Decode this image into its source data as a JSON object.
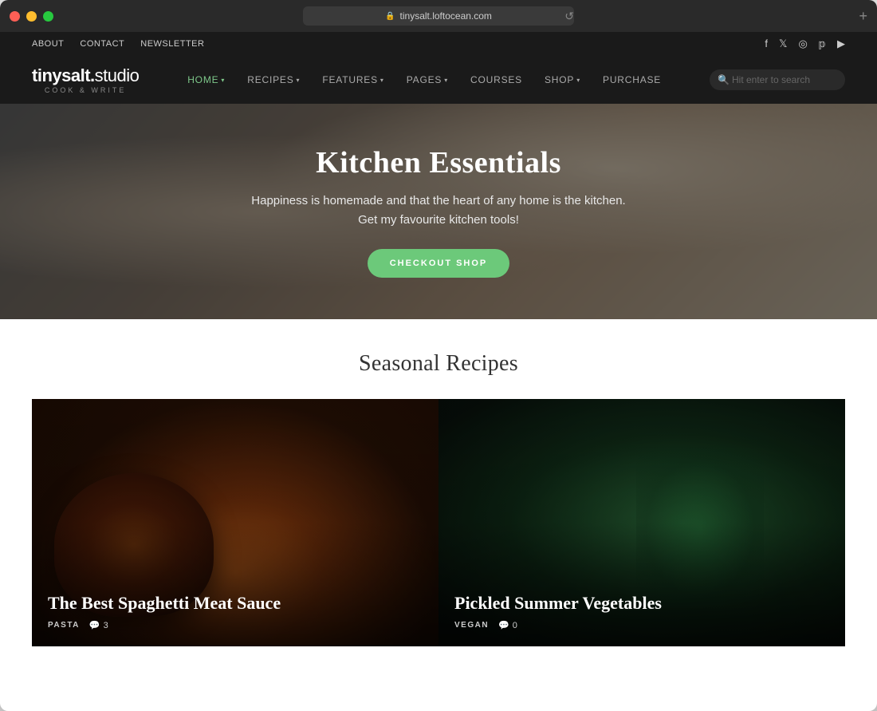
{
  "browser": {
    "url": "tinysalt.loftocean.com",
    "plus_btn": "+"
  },
  "util_bar": {
    "links": [
      "ABOUT",
      "CONTACT",
      "NEWSLETTER"
    ],
    "social_icons": [
      "f",
      "t",
      "i",
      "p",
      "yt"
    ]
  },
  "nav": {
    "logo_name": "tinysalt.studio",
    "logo_tagline": "COOK & WRITE",
    "items": [
      {
        "label": "HOME",
        "has_arrow": true,
        "active": true
      },
      {
        "label": "RECIPES",
        "has_arrow": true,
        "active": false
      },
      {
        "label": "FEATURES",
        "has_arrow": true,
        "active": false
      },
      {
        "label": "PAGES",
        "has_arrow": true,
        "active": false
      },
      {
        "label": "COURSES",
        "has_arrow": false,
        "active": false
      },
      {
        "label": "SHOP",
        "has_arrow": true,
        "active": false
      },
      {
        "label": "PURCHASE",
        "has_arrow": false,
        "active": false
      }
    ],
    "search_placeholder": "Hit enter to search"
  },
  "hero": {
    "title": "Kitchen Essentials",
    "subtitle_line1": "Happiness is homemade and that the heart of any home is the kitchen.",
    "subtitle_line2": "Get my favourite kitchen tools!",
    "button_label": "CHECKOUT SHOP"
  },
  "seasonal": {
    "title": "Seasonal Recipes",
    "cards": [
      {
        "title": "The Best Spaghetti Meat Sauce",
        "category": "PASTA",
        "comments": "3",
        "side": "left"
      },
      {
        "title": "Pickled Summer Vegetables",
        "category": "VEGAN",
        "comments": "0",
        "side": "right"
      }
    ]
  }
}
